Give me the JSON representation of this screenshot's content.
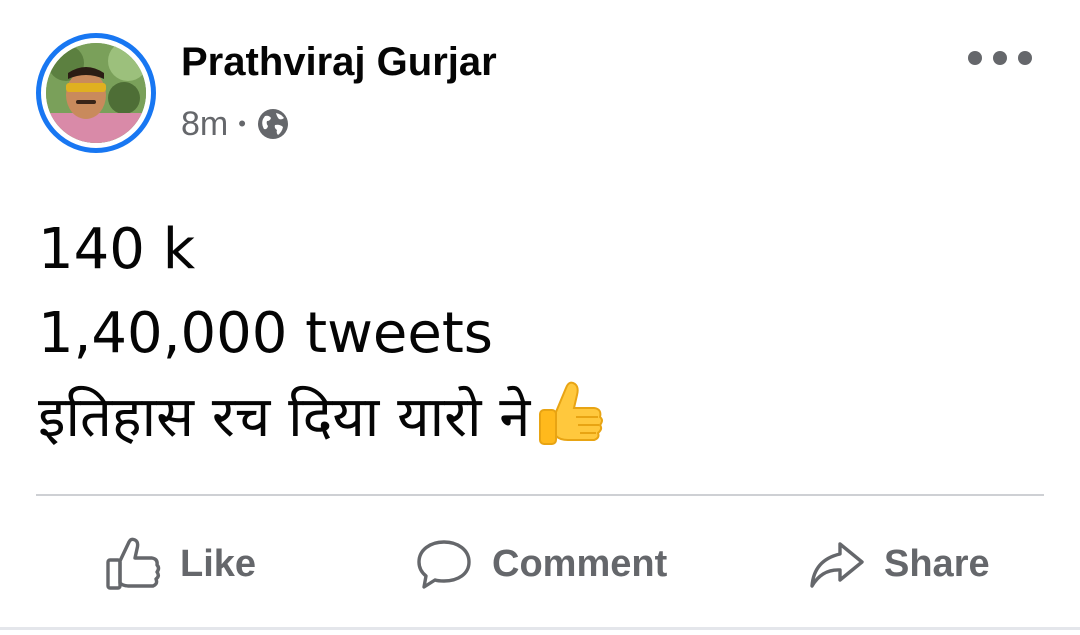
{
  "post": {
    "author": {
      "name": "Prathviraj Gurjar",
      "avatar_icon": "profile-photo",
      "ring_color": "#1877f2"
    },
    "meta": {
      "time": "8m",
      "separator": "•",
      "audience_icon": "globe-icon"
    },
    "menu_icon": "more-options-icon",
    "text_lines": [
      "140 k",
      "1,40,000 tweets",
      "इतिहास रच दिया यारो ने"
    ],
    "text_emoji": "thumbs-up-emoji",
    "actions": {
      "like": {
        "label": "Like",
        "icon": "thumbs-up-icon"
      },
      "comment": {
        "label": "Comment",
        "icon": "comment-bubble-icon"
      },
      "share": {
        "label": "Share",
        "icon": "share-arrow-icon"
      }
    }
  },
  "colors": {
    "text_primary": "#050505",
    "text_secondary": "#65676b",
    "accent": "#1877f2",
    "divider": "#ced0d4"
  }
}
